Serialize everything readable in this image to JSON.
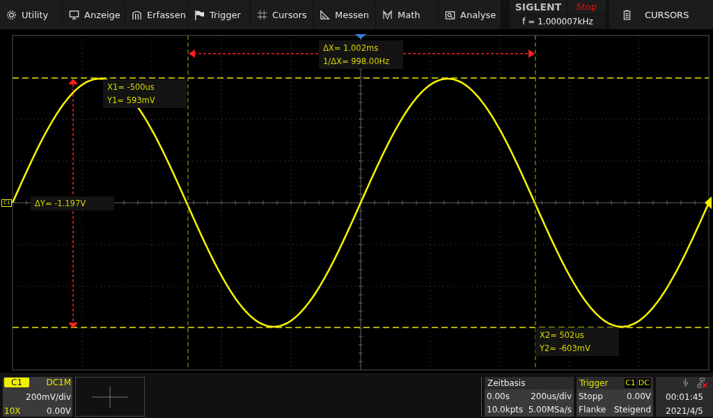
{
  "menu": [
    {
      "label": "Utility"
    },
    {
      "label": "Anzeige"
    },
    {
      "label": "Erfassen"
    },
    {
      "label": "Trigger"
    },
    {
      "label": "Cursors"
    },
    {
      "label": "Messen"
    },
    {
      "label": "Math"
    },
    {
      "label": "Analyse"
    }
  ],
  "brand": "SIGLENT",
  "run_state": "Stop",
  "frequency": "f = 1.000007kHz",
  "side_button": "CURSORS",
  "channel_marker": "C1",
  "cursors": {
    "dx": "ΔX= 1.002ms",
    "inv_dx": "1/ΔX= 998.00Hz",
    "x1": "X1= -500us",
    "y1": "Y1= 593mV",
    "dy": "ΔY= -1.197V",
    "x2": "X2= 502us",
    "y2": "Y2= -603mV"
  },
  "channel": {
    "name": "C1",
    "coupling": "DC1M",
    "scale": "200mV/div",
    "probe": "10X",
    "offset": "0.00V"
  },
  "timebase": {
    "title": "Zeitbasis",
    "delay": "0.00s",
    "scale": "200us/div",
    "memory": "10.0kpts",
    "sample_rate": "5.00MSa/s"
  },
  "trigger": {
    "title": "Trigger",
    "source": "C1",
    "coupling": "DC",
    "state": "Stopp",
    "trigger_level": "0.00V",
    "type": "Flanke",
    "slope": "Steigend"
  },
  "status": {
    "time": "00:01:45",
    "date": "2021/4/5"
  }
}
